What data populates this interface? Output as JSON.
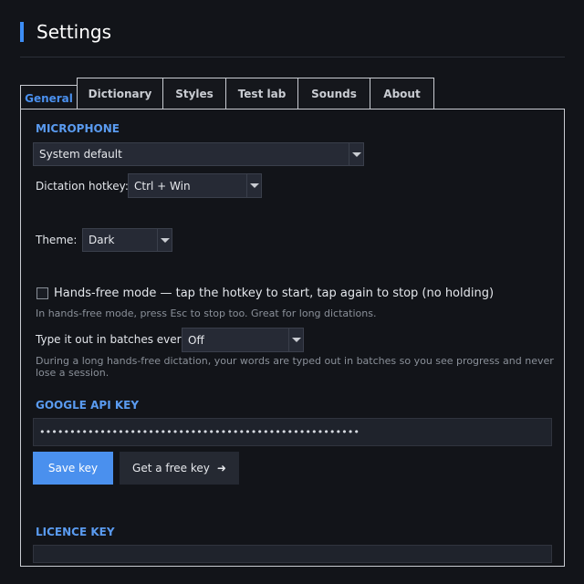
{
  "header": {
    "title": "Settings"
  },
  "tabs": [
    {
      "label": "General",
      "active": true
    },
    {
      "label": "Dictionary"
    },
    {
      "label": "Styles"
    },
    {
      "label": "Test lab"
    },
    {
      "label": "Sounds"
    },
    {
      "label": "About"
    }
  ],
  "microphone": {
    "heading": "MICROPHONE",
    "selected": "System default"
  },
  "hotkey": {
    "label": "Dictation hotkey:",
    "selected": "Ctrl + Win"
  },
  "theme": {
    "label": "Theme:",
    "selected": "Dark"
  },
  "hands_free": {
    "label": "Hands-free mode — tap the hotkey to start, tap again to stop (no holding)",
    "checked": false,
    "hint": "In hands-free mode, press Esc to stop too. Great for long dictations."
  },
  "batches": {
    "label": "Type it out in batches every:",
    "selected": "Off",
    "hint": "During a long hands-free dictation, your words are typed out in batches so you see progress and never lose a session."
  },
  "google_api": {
    "heading": "GOOGLE API KEY",
    "value": "•••••••••••••••••••••••••••••••••••••••••••••••••••••",
    "save_label": "Save key",
    "get_label": "Get a free key",
    "get_arrow": "➜"
  },
  "licence": {
    "heading": "LICENCE KEY",
    "value": ""
  },
  "colors": {
    "accent": "#4a90ee",
    "background": "#121419"
  }
}
